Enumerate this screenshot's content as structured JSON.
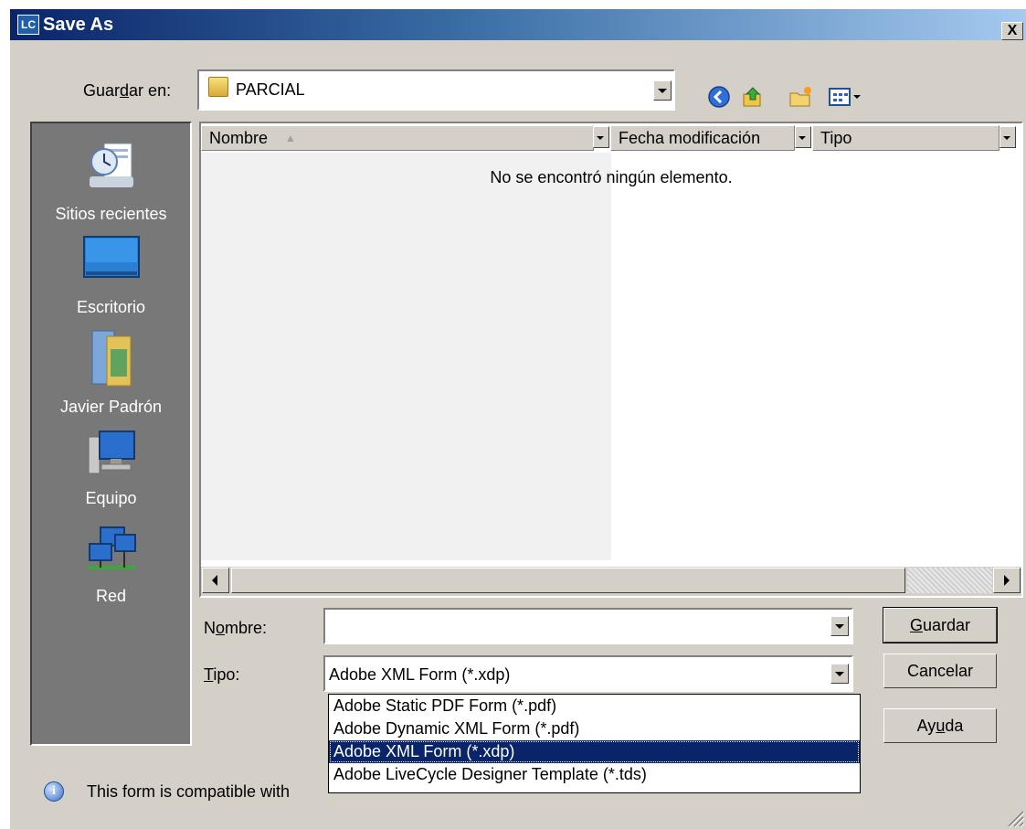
{
  "window": {
    "app_icon_text": "LC",
    "title": "Save As",
    "close_glyph": "X"
  },
  "save_in": {
    "label_pre": "Guar",
    "label_ul": "d",
    "label_post": "ar en:",
    "value": "PARCIAL",
    "toolbar_icons": [
      "back-icon",
      "up-folder-icon",
      "new-folder-icon",
      "views-menu-icon"
    ]
  },
  "places": [
    {
      "label": "Sitios recientes",
      "icon": "recent-places-icon"
    },
    {
      "label": "Escritorio",
      "icon": "desktop-icon"
    },
    {
      "label": "Javier Padrón",
      "icon": "user-folder-icon"
    },
    {
      "label": "Equipo",
      "icon": "computer-icon"
    },
    {
      "label": "Red",
      "icon": "network-icon"
    }
  ],
  "file_list": {
    "columns": [
      "Nombre",
      "Fecha modificación",
      "Tipo"
    ],
    "sort_indicator": "▲",
    "empty_message": "No se encontró ningún elemento."
  },
  "filename": {
    "label_pre": "N",
    "label_ul": "o",
    "label_post": "mbre:",
    "value": ""
  },
  "filetype": {
    "label_ul": "T",
    "label_post": "ipo:",
    "value": "Adobe XML Form (*.xdp)",
    "options": [
      "Adobe Static PDF Form (*.pdf)",
      "Adobe Dynamic XML Form (*.pdf)",
      "Adobe XML Form (*.xdp)",
      "Adobe LiveCycle Designer Template (*.tds)"
    ],
    "selected_index": 2
  },
  "buttons": {
    "save": {
      "ul": "G",
      "rest": "uardar"
    },
    "cancel": "Cancelar",
    "help": {
      "pre": "Ay",
      "ul": "u",
      "post": "da"
    }
  },
  "status": {
    "text": "This form is compatible with"
  },
  "colors": {
    "dialog_bg": "#d4d0c8",
    "title_start": "#0a246a",
    "title_end": "#a6caf0",
    "selection": "#0a246a",
    "places_bg": "#787878"
  }
}
